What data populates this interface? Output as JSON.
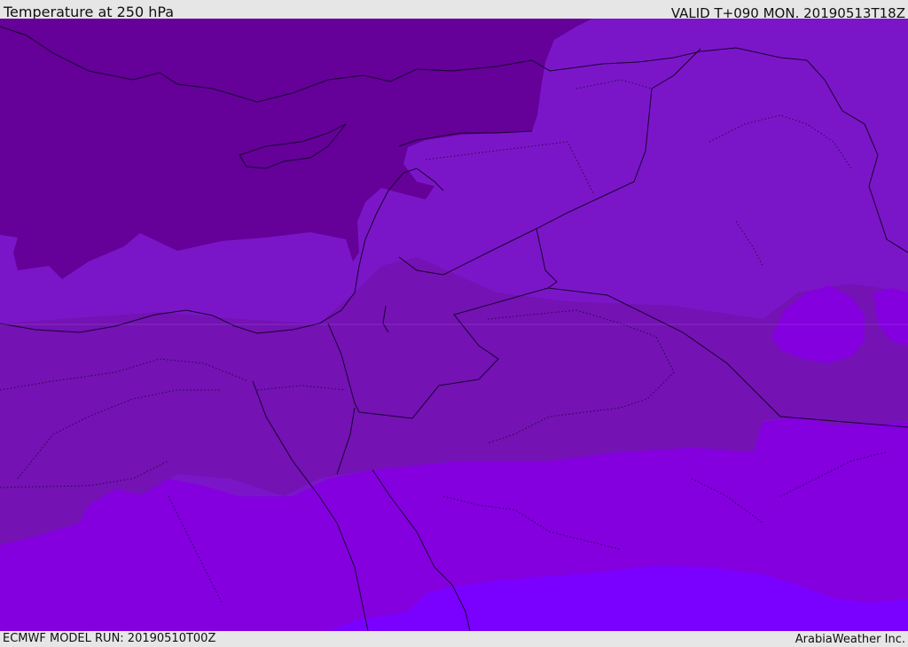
{
  "header": {
    "title": "Temperature at 250 hPa",
    "valid": "VALID T+090 MON. 20190513T18Z"
  },
  "footer": {
    "model_run": "ECMWF MODEL RUN: 20190510T00Z",
    "credit": "ArabiaWeather Inc."
  },
  "map": {
    "field": "temperature",
    "level": "250 hPa",
    "colors": {
      "band_coldest": "#650099",
      "band_cold": "#7412b4",
      "band_mid": "#7b16c8",
      "band_warm": "#8400df",
      "band_warmest": "#7a00ff",
      "border": "#1a0030"
    }
  }
}
